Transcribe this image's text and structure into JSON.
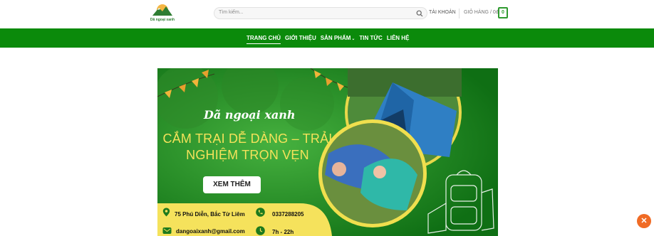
{
  "header": {
    "brand": "Dã ngoại xanh",
    "search_placeholder": "Tìm kiếm...",
    "account_label": "TÀI KHOẢN",
    "cart_label": "GIỎ HÀNG / 0đ",
    "cart_count": "0"
  },
  "nav": {
    "items": [
      {
        "label": "TRANG CHỦ",
        "active": true
      },
      {
        "label": "GIỚI THIỆU"
      },
      {
        "label": "SẢN PHẨM",
        "chevron": "chevron-down-icon"
      },
      {
        "label": "TIN TỨC"
      },
      {
        "label": "LIÊN HỆ"
      }
    ]
  },
  "banner": {
    "brand": "Dã ngoại xanh",
    "title_line1": "CẮM TRẠI DỄ DÀNG – TRẢI",
    "title_line2": "NGHIỆM TRỌN VẸN",
    "cta": "XEM THÊM",
    "address": "75 Phú Diễn, Bắc Từ Liêm",
    "phone": "0337288205",
    "email": "dangoaixanh@gmail.com",
    "hours": "7h - 22h"
  },
  "colors": {
    "nav_green": "#0b8a0b",
    "banner_green": "#1f8a1e",
    "accent_yellow": "#f4e25a",
    "fab_orange": "#f06b25"
  }
}
